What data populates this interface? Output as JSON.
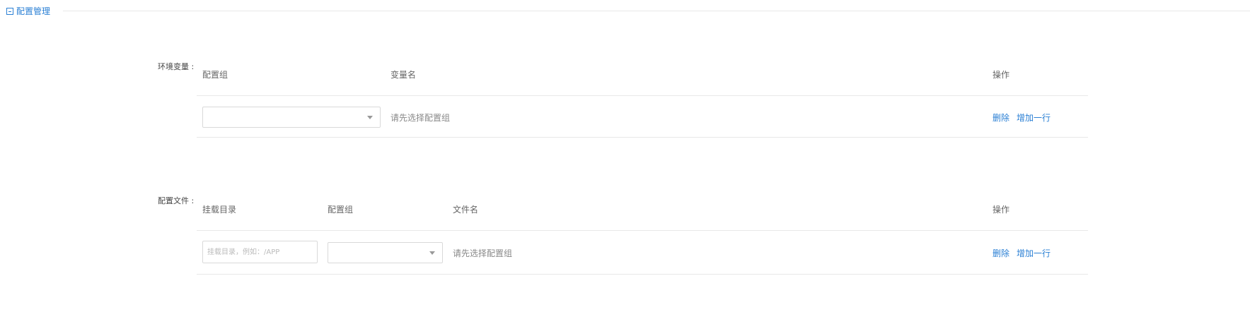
{
  "section": {
    "title": "配置管理"
  },
  "env_vars": {
    "label": "环境变量 :",
    "headers": {
      "config_group": "配置组",
      "var_name": "变量名",
      "action": "操作"
    },
    "row": {
      "config_group_value": "",
      "var_name_text": "请先选择配置组",
      "delete_label": "删除",
      "add_row_label": "增加一行"
    }
  },
  "config_files": {
    "label": "配置文件 :",
    "headers": {
      "mount_dir": "挂载目录",
      "config_group": "配置组",
      "file_name": "文件名",
      "action": "操作"
    },
    "row": {
      "mount_dir_placeholder": "挂载目录，例如：/APP",
      "config_group_value": "",
      "file_name_text": "请先选择配置组",
      "delete_label": "删除",
      "add_row_label": "增加一行"
    }
  },
  "colors": {
    "accent": "#2a7fd4",
    "border": "#d9d9d9",
    "divider": "#e8e8e8"
  }
}
